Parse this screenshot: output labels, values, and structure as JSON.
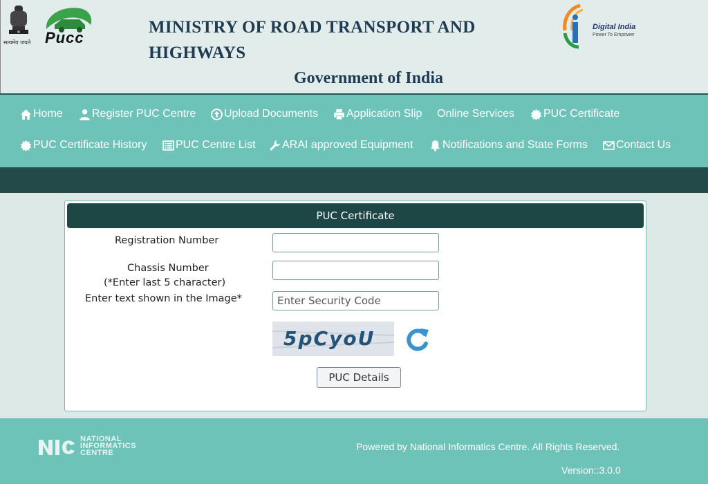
{
  "header": {
    "emblem_caption": "सत्यमेव जयते",
    "pucc_logo_text": "Pucc",
    "title_line1": "MINISTRY OF ROAD TRANSPORT AND",
    "title_line2": "HIGHWAYS",
    "subtitle": "Government of India",
    "digital_india_title": "Digital India",
    "digital_india_tagline": "Power To Empower"
  },
  "nav": {
    "items": [
      {
        "label": "Home",
        "icon": "home-icon"
      },
      {
        "label": "Register PUC Centre",
        "icon": "user-icon"
      },
      {
        "label": "Upload Documents",
        "icon": "upload-icon"
      },
      {
        "label": "Application Slip",
        "icon": "print-icon"
      },
      {
        "label": "Online Services",
        "icon": ""
      },
      {
        "label": "PUC Certificate",
        "icon": "certificate-icon"
      },
      {
        "label": "PUC Certificate History",
        "icon": "certificate-icon"
      },
      {
        "label": "PUC Centre List",
        "icon": "list-icon"
      },
      {
        "label": "ARAI approved Equipment",
        "icon": "wrench-icon"
      },
      {
        "label": "Notifications and State Forms",
        "icon": "bell-icon"
      },
      {
        "label": "Contact Us",
        "icon": "envelope-icon"
      }
    ]
  },
  "form": {
    "heading": "PUC Certificate",
    "registration_label": "Registration Number",
    "registration_value": "",
    "chassis_label": "Chassis Number",
    "chassis_hint": "(*Enter last 5 character)",
    "chassis_value": "",
    "captcha_label": "Enter text shown in the Image*",
    "captcha_placeholder": "Enter Security Code",
    "captcha_text": "5pCyoU",
    "submit_label": "PUC Details"
  },
  "footer": {
    "nic_line1": "NATIONAL",
    "nic_line2": "INFORMATICS",
    "nic_line3": "CENTRE",
    "powered_by": "Powered by National Informatics Centre. All Rights Reserved.",
    "version": "Version::3.0.0"
  },
  "colors": {
    "header_bg": "#e2ecea",
    "nav_bg": "#6ec3b9",
    "dark_band": "#234a48",
    "panel_head": "#1d4745",
    "title_text": "#1e3b52"
  }
}
